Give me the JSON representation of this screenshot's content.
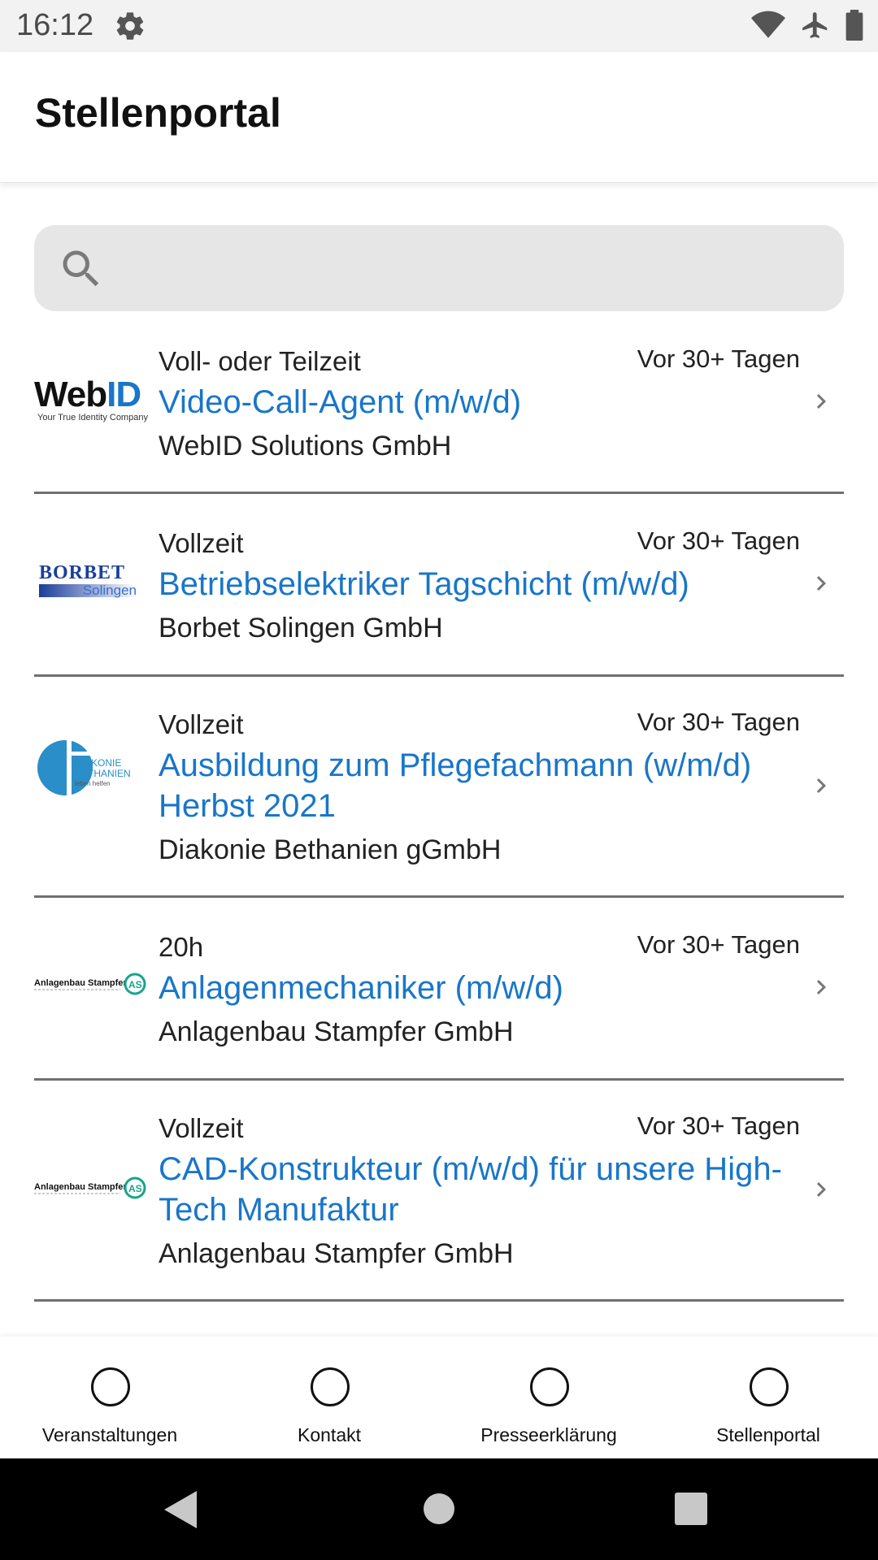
{
  "status_bar": {
    "time": "16:12"
  },
  "app_bar": {
    "title": "Stellenportal"
  },
  "search": {
    "placeholder": ""
  },
  "jobs": [
    {
      "logo": "WebID",
      "logo_sub": "Your True Identity Company",
      "type": "Voll- oder Teilzeit",
      "date": "Vor 30+ Tagen",
      "title": "Video-Call-Agent (m/w/d)",
      "company": "WebID Solutions GmbH"
    },
    {
      "logo": "BORBET",
      "logo_sub": "Solingen",
      "type": "Vollzeit",
      "date": "Vor 30+ Tagen",
      "title": "Betriebselektriker Tagschicht (m/w/d)",
      "company": "Borbet Solingen GmbH"
    },
    {
      "logo": "DIAKONIE BETHANIEN",
      "logo_sub": "leben helfen",
      "type": "Vollzeit",
      "date": "Vor 30+ Tagen",
      "title": "Ausbildung zum Pflegefachmann (w/m/d) Herbst 2021",
      "company": "Diakonie Bethanien gGmbH"
    },
    {
      "logo": "Anlagenbau Stampfer",
      "logo_sub": "",
      "type": "20h",
      "date": "Vor 30+ Tagen",
      "title": "Anlagenmechaniker (m/w/d)",
      "company": "Anlagenbau Stampfer GmbH"
    },
    {
      "logo": "Anlagenbau Stampfer",
      "logo_sub": "",
      "type": "Vollzeit",
      "date": "Vor 30+ Tagen",
      "title": "CAD-Konstrukteur (m/w/d) für unsere High-Tech Manufaktur",
      "company": "Anlagenbau Stampfer GmbH"
    }
  ],
  "bottom_nav": [
    {
      "label": "Veranstaltungen"
    },
    {
      "label": "Kontakt"
    },
    {
      "label": "Presseerklärung"
    },
    {
      "label": "Stellenportal"
    }
  ],
  "colors": {
    "accent": "#1976c9",
    "divider": "#707070",
    "search_bg": "#e6e6e6"
  }
}
